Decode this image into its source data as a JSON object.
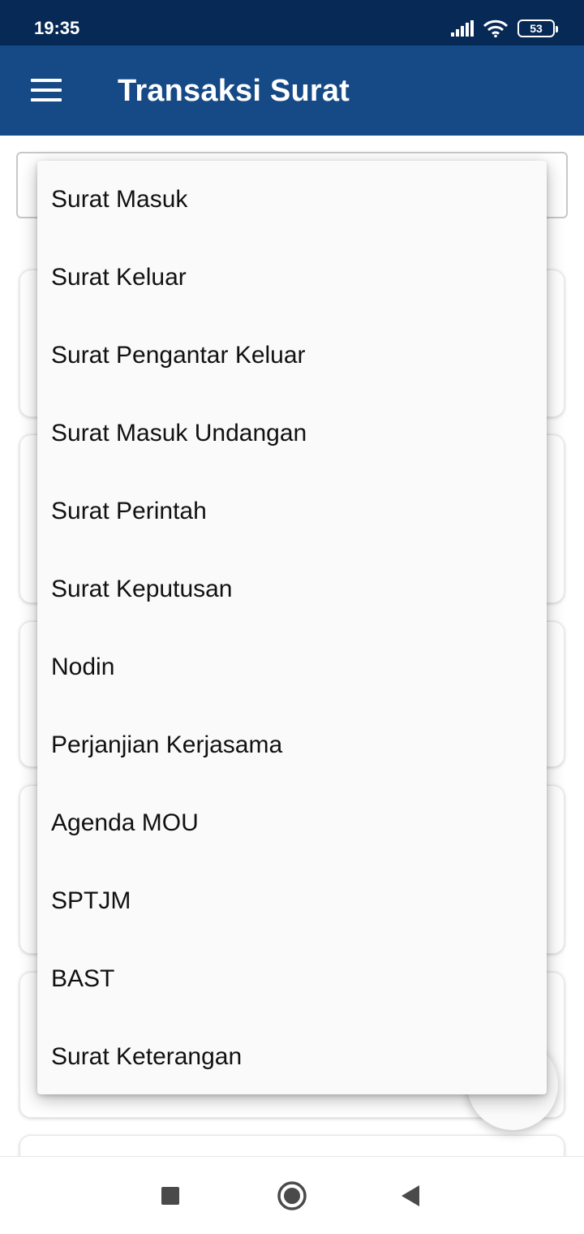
{
  "status_bar": {
    "time": "19:35",
    "battery_level": "53",
    "icons": [
      "signal-icon",
      "wifi-icon",
      "battery-icon"
    ]
  },
  "app_bar": {
    "title": "Transaksi Surat",
    "menu_icon": "hamburger-menu-icon"
  },
  "dropdown": {
    "items": [
      {
        "label": "Surat Masuk"
      },
      {
        "label": "Surat Keluar"
      },
      {
        "label": "Surat Pengantar Keluar"
      },
      {
        "label": "Surat Masuk Undangan"
      },
      {
        "label": "Surat Perintah"
      },
      {
        "label": "Surat Keputusan"
      },
      {
        "label": "Nodin"
      },
      {
        "label": "Perjanjian Kerjasama"
      },
      {
        "label": "Agenda MOU"
      },
      {
        "label": "SPTJM"
      },
      {
        "label": "BAST"
      },
      {
        "label": "Surat Keterangan"
      }
    ]
  },
  "nav_bar": {
    "icons": [
      "recent-apps-icon",
      "home-icon",
      "back-icon"
    ]
  },
  "colors": {
    "status_bar": "#062a55",
    "app_bar": "#164a86",
    "dropdown_bg": "#fafafa"
  }
}
